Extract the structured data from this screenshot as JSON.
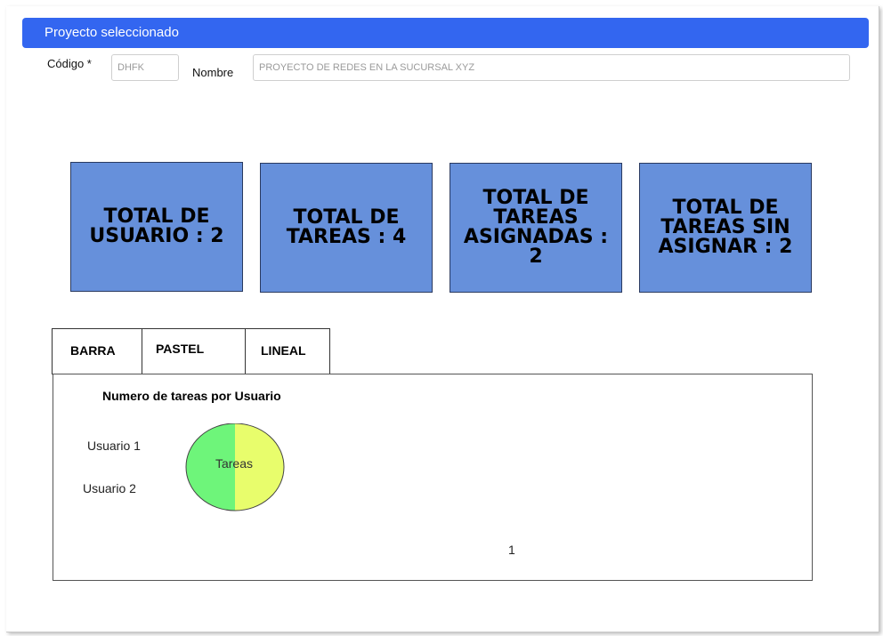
{
  "header": {
    "title": "Proyecto seleccionado"
  },
  "form": {
    "code_label": "Código *",
    "code_value": "DHFK",
    "name_label": "Nombre",
    "name_value": "PROYECTO DE REDES EN LA SUCURSAL XYZ"
  },
  "cards": [
    {
      "label": "TOTAL DE USUARIO : 2"
    },
    {
      "label": "TOTAL DE TAREAS : 4"
    },
    {
      "label": "TOTAL DE TAREAS ASIGNADAS : 2"
    },
    {
      "label": "TOTAL DE TAREAS SIN ASIGNAR : 2"
    }
  ],
  "tabs": [
    {
      "label": "BARRA"
    },
    {
      "label": "PASTEL"
    },
    {
      "label": "LINEAL"
    }
  ],
  "colors": {
    "header": "#3366f0",
    "card": "#6690db",
    "slice_1": "#6ef57a",
    "slice_2": "#e8fd6c"
  },
  "chart_data": {
    "type": "pie",
    "title": "Numero de tareas por Usuario",
    "categories": [
      "Usuario 1",
      "Usuario 2"
    ],
    "series": [
      {
        "name": "Tareas",
        "values": [
          1,
          1
        ]
      }
    ],
    "center_label": "Tareas",
    "page_indicator": "1"
  }
}
